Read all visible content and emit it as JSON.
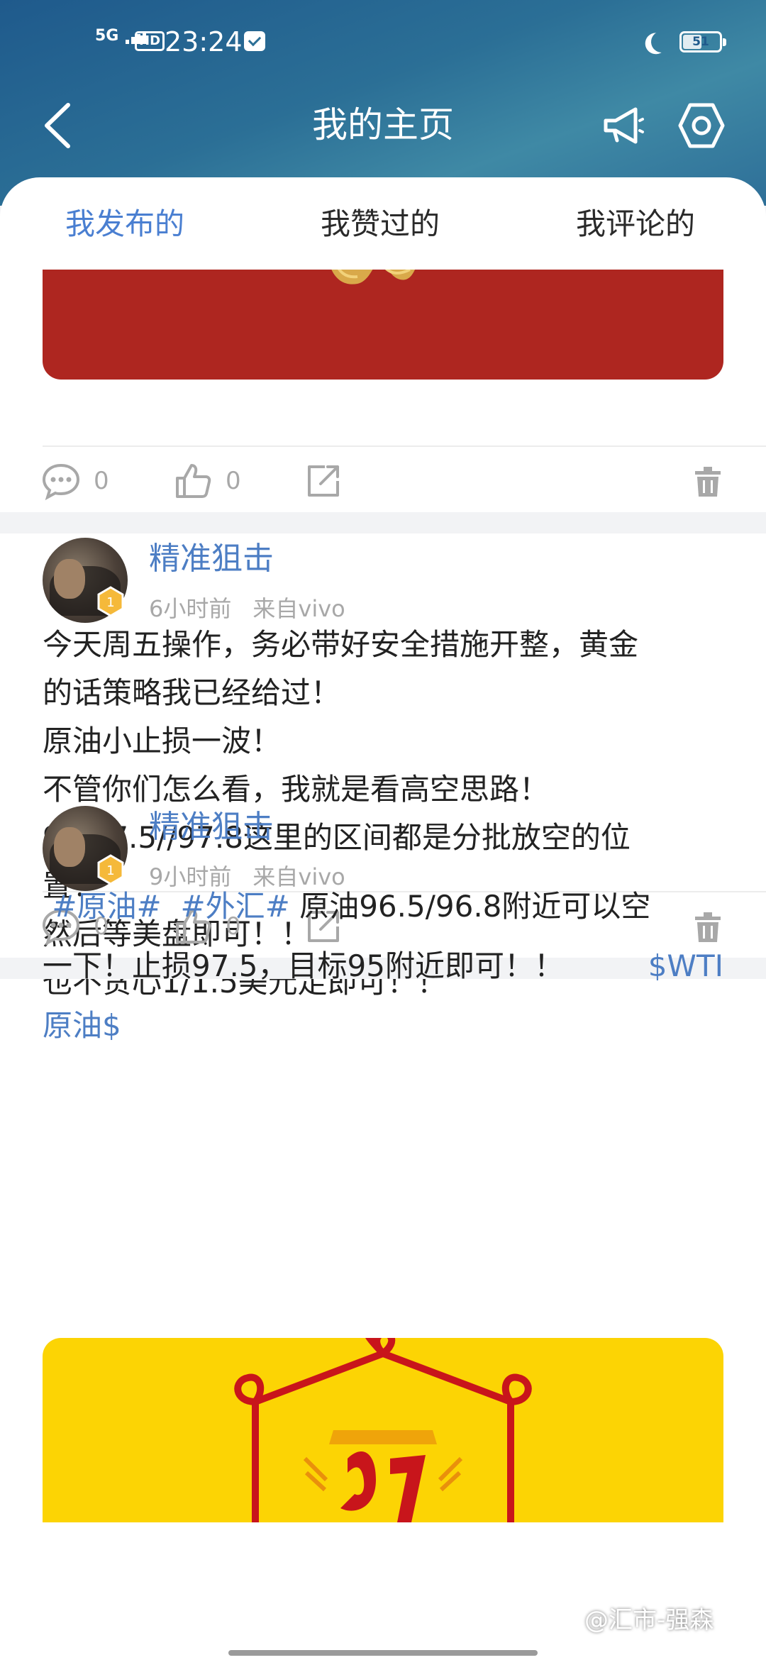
{
  "status_bar": {
    "network": "5G",
    "hd": "HD",
    "time": "23:24",
    "battery": "51"
  },
  "nav": {
    "title": "我的主页",
    "back_icon": "chevron-left-icon",
    "announce_icon": "megaphone-icon",
    "settings_icon": "hexagon-gear-icon"
  },
  "tabs": [
    {
      "label": "我发布的",
      "active": true
    },
    {
      "label": "我赞过的",
      "active": false
    },
    {
      "label": "我评论的",
      "active": false
    }
  ],
  "colors": {
    "accent": "#4a7fd1",
    "header_gradient": "#2b6f96",
    "post1_image_bg": "#ae2620",
    "post3_image_bg": "#fcd404"
  },
  "posts": [
    {
      "comments": "0",
      "likes": "0"
    },
    {
      "author": "精准狙击",
      "level": "1",
      "time": "6小时前",
      "source": "来自vivo",
      "lines": [
        "今天周五操作，务必带好安全措施开整，黄金",
        "的话策略我已经给过！",
        "原油小止损一波！",
        "不管你们怎么看，我就是看高空思路！",
        "97/97.5//97.8这里的区间都是分批放空的位",
        "置！",
        "然后等美盘即可！！",
        "也不贪心1/1.5美元走即可！！"
      ],
      "comments": "0",
      "likes": "0"
    },
    {
      "author": "精准狙击",
      "level": "1",
      "time": "9小时前",
      "source": "来自vivo",
      "tag1": "#原油#",
      "tag2": "#外汇#",
      "text_line1": "原油96.5/96.8附近可以空",
      "text_line2": "一下！止损97.5，目标95附近即可！！",
      "stock_tag_a": "$WTI",
      "stock_tag_b": "原油$"
    }
  ],
  "watermark": "@汇市-强森"
}
